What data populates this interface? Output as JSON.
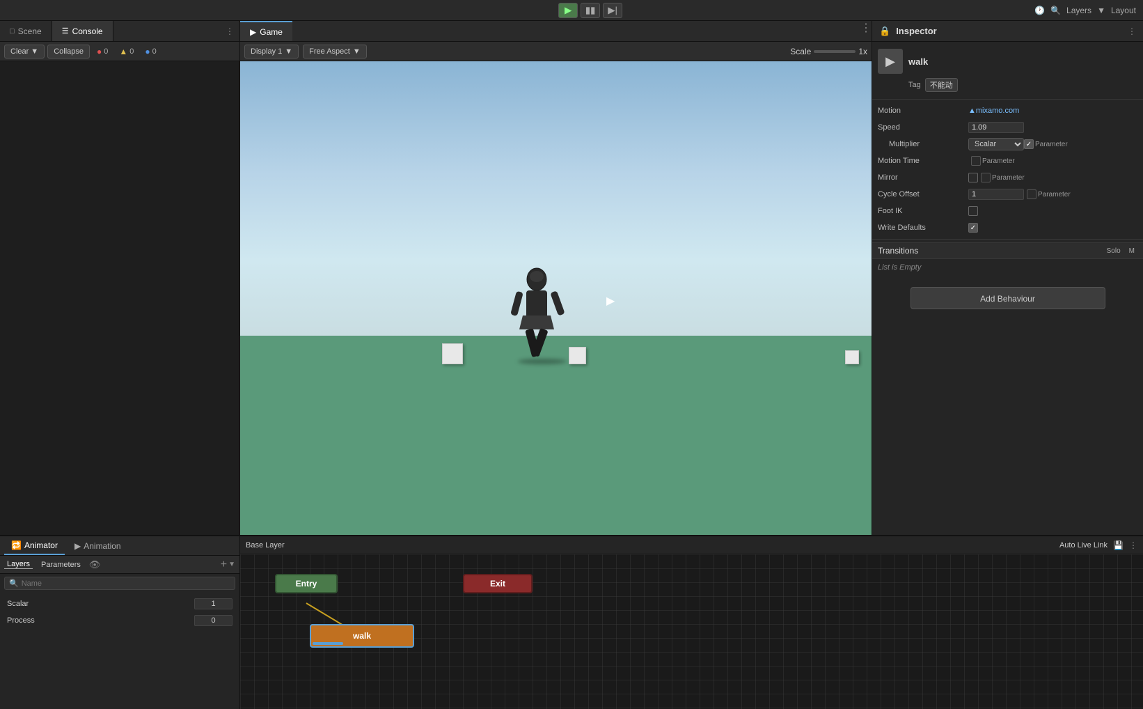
{
  "topbar": {
    "play_active": true,
    "layers_label": "Layers",
    "layout_label": "Layout"
  },
  "console": {
    "tab_scene": "Scene",
    "tab_console": "Console",
    "btn_clear": "Clear",
    "btn_collapse": "Collapse",
    "count_error": "0",
    "count_warn": "0",
    "count_info": "0"
  },
  "game": {
    "tab_label": "Game",
    "display_label": "Display 1",
    "aspect_label": "Free Aspect",
    "scale_label": "Scale",
    "scale_value": "1x"
  },
  "inspector": {
    "title": "Inspector",
    "asset_name": "walk",
    "tag_label": "Tag",
    "tag_value": "不能动",
    "motion_label": "Motion",
    "motion_value": "▲mixamo.com",
    "speed_label": "Speed",
    "speed_value": "1.09",
    "multiplier_label": "Multiplier",
    "multiplier_value": "Scalar",
    "param_label": "Parameter",
    "motion_time_label": "Motion Time",
    "mirror_label": "Mirror",
    "cycle_offset_label": "Cycle Offset",
    "cycle_offset_value": "1",
    "foot_ik_label": "Foot IK",
    "write_defaults_label": "Write Defaults",
    "transitions_label": "Transitions",
    "solo_label": "Solo",
    "mute_label": "M",
    "list_empty": "List is Empty",
    "add_behaviour": "Add Behaviour"
  },
  "animator": {
    "tab_animator": "Animator",
    "tab_animation": "Animation",
    "tab_layers": "Layers",
    "tab_parameters": "Parameters",
    "search_placeholder": "Name",
    "base_layer": "Base Layer",
    "auto_live_link": "Auto Live Link",
    "params": [
      {
        "name": "Scalar",
        "value": "1"
      },
      {
        "name": "Process",
        "value": "0"
      }
    ],
    "states": {
      "entry": "Entry",
      "exit": "Exit",
      "walk": "walk"
    }
  }
}
